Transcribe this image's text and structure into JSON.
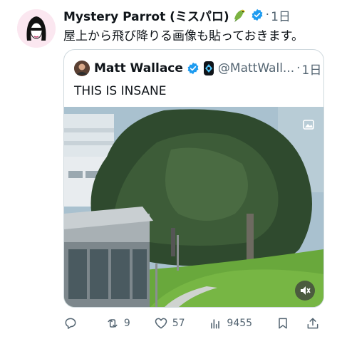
{
  "post": {
    "author_name": "Mystery Parrot (ミスパロ)",
    "time": "1日",
    "text": "屋上から飛び降りる画像も貼っておきます。"
  },
  "quote": {
    "author_name": "Matt Wallace",
    "handle": "@MattWall...",
    "time": "1日",
    "text": "THIS IS INSANE"
  },
  "actions": {
    "replies": "",
    "reposts": "9",
    "likes": "57",
    "views": "9455"
  },
  "colors": {
    "verified": "#1d9bf0",
    "muted_text": "#536471",
    "border": "#cfd9de"
  }
}
